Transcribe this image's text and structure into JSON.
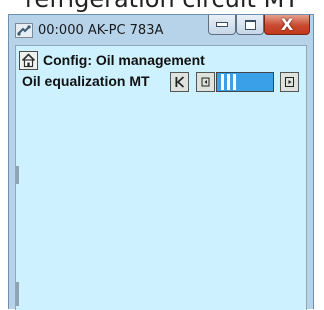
{
  "caption": "refrigeration circuit MT",
  "window": {
    "title": "00:000 AK-PC 783A",
    "controls": {
      "minimize_icon": "minimize-icon",
      "maximize_icon": "maximize-icon",
      "close_glyph": "X"
    },
    "app_icon": "remote-connection-icon"
  },
  "page": {
    "home_icon": "home-icon",
    "title": "Config: Oil management",
    "parameter": {
      "label": "Oil equalization MT",
      "buttons": [
        "first-icon",
        "previous-icon",
        "next-icon"
      ],
      "value_bars": 3
    }
  },
  "colors": {
    "window_frame": "#b6d3ea",
    "client_background": "#cdf1fe",
    "value_field": "#3aa0e8",
    "close_button": "#c84a30"
  }
}
